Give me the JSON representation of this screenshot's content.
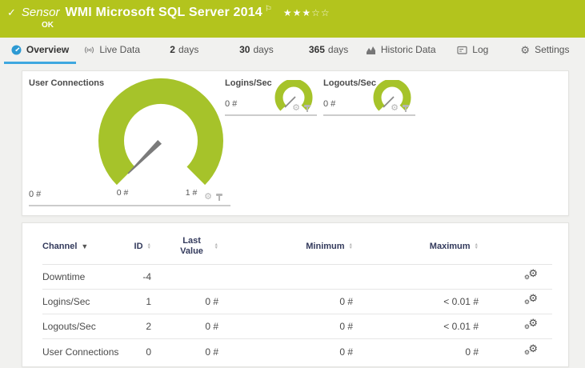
{
  "colors": {
    "banner_green": "#b3c41d",
    "gauge_green": "#a6c32a",
    "accent_blue": "#3fa8e0",
    "tab_icon_blue": "#2d9ad3",
    "header_navy": "#333a5c"
  },
  "banner": {
    "check": "✓",
    "kind": "Sensor",
    "title": "WMI Microsoft SQL Server 2014",
    "flag": "⚐",
    "stars_filled": "★★★",
    "stars_empty": "☆☆",
    "status": "OK"
  },
  "tabs": [
    {
      "label": "Overview"
    },
    {
      "label": "Live Data"
    },
    {
      "num": "2",
      "label": "days"
    },
    {
      "num": "30",
      "label": "days"
    },
    {
      "num": "365",
      "label": "days"
    },
    {
      "label": "Historic Data"
    },
    {
      "label": "Log"
    },
    {
      "label": "Settings"
    }
  ],
  "gauges": {
    "user_connections": {
      "title": "User Connections",
      "current": "0 #",
      "scale_min": "0 #",
      "scale_max": "1 #"
    },
    "logins": {
      "title": "Logins/Sec",
      "current": "0 #"
    },
    "logouts": {
      "title": "Logouts/Sec",
      "current": "0 #"
    }
  },
  "table": {
    "headers": {
      "channel": "Channel",
      "id": "ID",
      "last_value": "Last Value",
      "minimum": "Minimum",
      "maximum": "Maximum"
    },
    "rows": [
      {
        "channel": "Downtime",
        "id": "-4",
        "last": "",
        "min": "",
        "max": ""
      },
      {
        "channel": "Logins/Sec",
        "id": "1",
        "last": "0 #",
        "min": "0 #",
        "max": "< 0.01 #"
      },
      {
        "channel": "Logouts/Sec",
        "id": "2",
        "last": "0 #",
        "min": "0 #",
        "max": "< 0.01 #"
      },
      {
        "channel": "User Connections",
        "id": "0",
        "last": "0 #",
        "min": "0 #",
        "max": "0 #"
      }
    ]
  }
}
